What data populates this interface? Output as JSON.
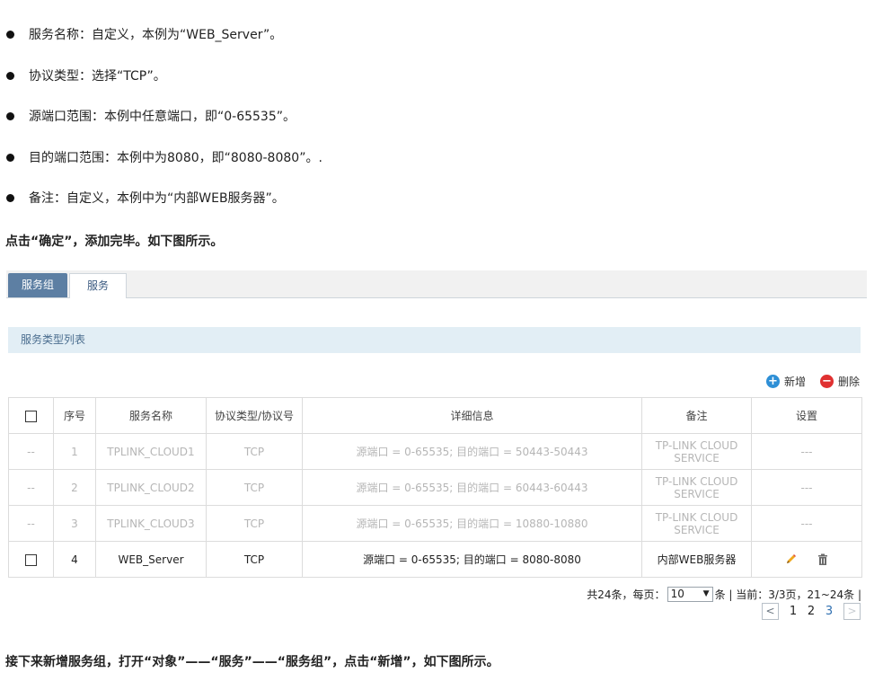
{
  "bullets": [
    "服务名称：自定义，本例为“WEB_Server”。",
    "协议类型：选择“TCP”。",
    "源端口范围：本例中任意端口，即“0-65535”。",
    "目的端口范围：本例中为8080，即“8080-8080”。.",
    "备注：自定义，本例中为“内部WEB服务器”。"
  ],
  "confirm_line": "点击“确定”，添加完毕。如下图所示。",
  "tabs": [
    {
      "label": "服务组"
    },
    {
      "label": "服务"
    }
  ],
  "panel_title": "服务类型列表",
  "actions": {
    "add_label": "新增",
    "delete_label": "删除"
  },
  "table": {
    "headers": [
      "序号",
      "服务名称",
      "协议类型/协议号",
      "详细信息",
      "备注",
      "设置"
    ],
    "rows": [
      {
        "check": "--",
        "no": "1",
        "name": "TPLINK_CLOUD1",
        "protocol": "TCP",
        "detail": "源端口 = 0-65535; 目的端口 = 50443-50443",
        "note_line1": "TP-LINK CLOUD",
        "note_line2": "SERVICE",
        "settings": "---"
      },
      {
        "check": "--",
        "no": "2",
        "name": "TPLINK_CLOUD2",
        "protocol": "TCP",
        "detail": "源端口 = 0-65535; 目的端口 = 60443-60443",
        "note_line1": "TP-LINK CLOUD",
        "note_line2": "SERVICE",
        "settings": "---"
      },
      {
        "check": "--",
        "no": "3",
        "name": "TPLINK_CLOUD3",
        "protocol": "TCP",
        "detail": "源端口 = 0-65535; 目的端口 = 10880-10880",
        "note_line1": "TP-LINK CLOUD",
        "note_line2": "SERVICE",
        "settings": "---"
      },
      {
        "no": "4",
        "name": "WEB_Server",
        "protocol": "TCP",
        "detail": "源端口 = 0-65535; 目的端口 = 8080-8080",
        "note": "内部WEB服务器"
      }
    ]
  },
  "pager": {
    "total_prefix": "共24条，每页：",
    "per_page": "10",
    "per_page_suffix": "条 | 当前：3/3页，21~24条 |",
    "prev": "<",
    "next": ">",
    "pages": [
      "1",
      "2",
      "3"
    ]
  },
  "next_line": "接下来新增服务组，打开“对象”——“服务”——“服务组”，点击“新增”，如下图所示。",
  "colors": {
    "tab_active": "#5d7fa3",
    "panel_head": "#e2eef5",
    "add": "#2e8fd6",
    "delete": "#e03131",
    "current_page": "#2e6fb0"
  }
}
